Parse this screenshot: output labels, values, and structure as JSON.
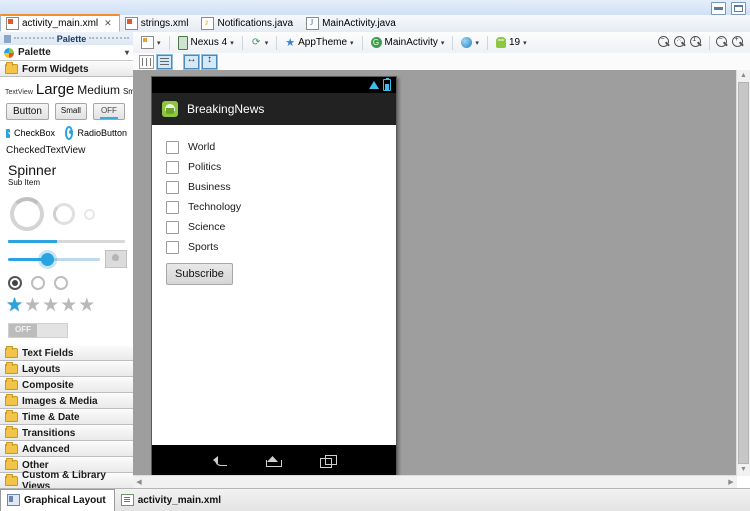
{
  "window": {
    "minimize_label": "Minimize",
    "maximize_label": "Maximize"
  },
  "editor_tabs": [
    {
      "label": "activity_main.xml",
      "icon": "xml-file-icon",
      "active": true,
      "close": "✕"
    },
    {
      "label": "strings.xml",
      "icon": "xml-file-icon",
      "active": false
    },
    {
      "label": "Notifications.java",
      "icon": "java-music-file-icon",
      "active": false
    },
    {
      "label": "MainActivity.java",
      "icon": "java-file-icon",
      "active": false
    }
  ],
  "palette": {
    "panel_title": "Palette",
    "header_label": "Palette",
    "header_chevron": "▾",
    "category_open": "Form Widgets",
    "textview_samples": {
      "textview": "TextView",
      "large": "Large",
      "medium": "Medium",
      "small": "Small"
    },
    "buttons": {
      "button": "Button",
      "small": "Small",
      "toggle": "OFF"
    },
    "checkbox_label": "CheckBox",
    "radiobutton_label": "RadioButton",
    "checkedtextview_label": "CheckedTextView",
    "spinner_label": "Spinner",
    "spinner_sub_label": "Sub Item",
    "switch_label": "OFF",
    "categories": [
      "Text Fields",
      "Layouts",
      "Composite",
      "Images & Media",
      "Time & Date",
      "Transitions",
      "Advanced",
      "Other",
      "Custom & Library Views"
    ]
  },
  "design_toolbar": {
    "layout_config": "",
    "device": "Nexus 4",
    "orientation": "",
    "theme": "AppTheme",
    "activity": "MainActivity",
    "locale": "",
    "api_level": "19",
    "caret": "▾",
    "zoom_buttons": [
      {
        "name": "zoom-out-icon",
        "sign": "−"
      },
      {
        "name": "zoom-fit-icon",
        "sign": "⁙"
      },
      {
        "name": "zoom-actual-size-icon",
        "sign": "1"
      },
      {
        "name": "zoom-out-2-icon",
        "sign": "−"
      },
      {
        "name": "zoom-in-icon",
        "sign": "+"
      }
    ]
  },
  "view_toggles": [
    {
      "name": "show-columns-toggle",
      "selected": false
    },
    {
      "name": "show-rows-toggle",
      "selected": true
    },
    {
      "name": "toggle-width-constraint",
      "selected": true
    },
    {
      "name": "toggle-height-constraint",
      "selected": true
    }
  ],
  "preview": {
    "app_title": "BreakingNews",
    "status_icons": [
      "wifi-icon",
      "battery-icon"
    ],
    "checkboxes": [
      {
        "label": "World",
        "checked": false
      },
      {
        "label": "Politics",
        "checked": false
      },
      {
        "label": "Business",
        "checked": false
      },
      {
        "label": "Technology",
        "checked": false
      },
      {
        "label": "Science",
        "checked": false
      },
      {
        "label": "Sports",
        "checked": false
      }
    ],
    "subscribe_button": "Subscribe",
    "nav_buttons": [
      "back-icon",
      "home-icon",
      "recents-icon"
    ]
  },
  "scrollbars": {
    "up_arrow": "▲",
    "down_arrow": "▼",
    "left_arrow": "◀",
    "right_arrow": "▶"
  },
  "bottom_tabs": [
    {
      "label": "Graphical Layout",
      "icon": "graphical-layout-icon",
      "active": true
    },
    {
      "label": "activity_main.xml",
      "icon": "xml-icon",
      "active": false
    }
  ]
}
